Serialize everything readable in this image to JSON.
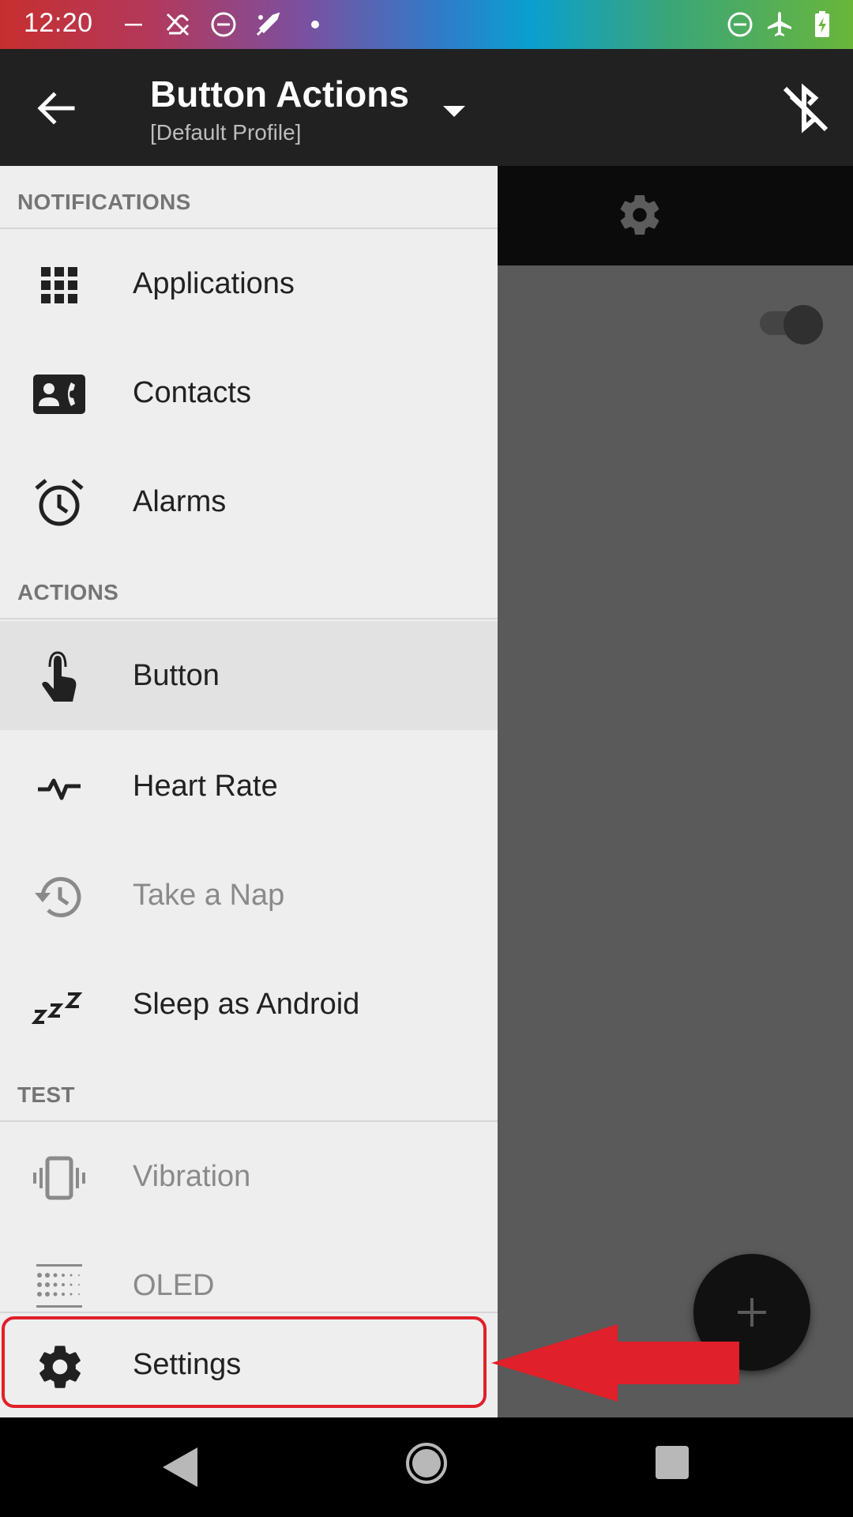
{
  "status_bar": {
    "time": "12:20"
  },
  "toolbar": {
    "title": "Button Actions",
    "subtitle": "[Default Profile]"
  },
  "drawer": {
    "sections": [
      {
        "header": "NOTIFICATIONS",
        "items": [
          {
            "label": "Applications",
            "icon": "apps-grid-icon"
          },
          {
            "label": "Contacts",
            "icon": "contact-phone-icon"
          },
          {
            "label": "Alarms",
            "icon": "alarm-clock-icon"
          }
        ]
      },
      {
        "header": "ACTIONS",
        "items": [
          {
            "label": "Button",
            "icon": "touch-hand-icon",
            "selected": true
          },
          {
            "label": "Heart Rate",
            "icon": "heart-rate-icon"
          },
          {
            "label": "Take a Nap",
            "icon": "history-icon",
            "disabled": true
          },
          {
            "label": "Sleep as Android",
            "icon": "sleep-zzz-icon"
          }
        ]
      },
      {
        "header": "TEST",
        "items": [
          {
            "label": "Vibration",
            "icon": "vibration-icon",
            "disabled": true
          },
          {
            "label": "OLED",
            "icon": "oled-dots-icon",
            "disabled": true
          }
        ]
      }
    ],
    "settings_label": "Settings"
  },
  "colors": {
    "toolbar_bg": "#212121",
    "drawer_bg": "#eeeeee",
    "annotation_red": "#e0202a"
  }
}
